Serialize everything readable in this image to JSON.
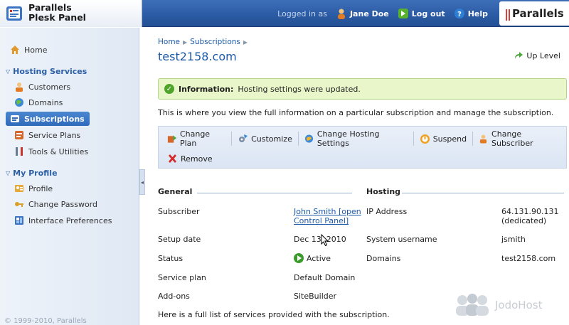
{
  "header": {
    "logo_line1": "Parallels",
    "logo_line2": "Plesk Panel",
    "logged_in_label": "Logged in as",
    "user_name": "Jane Doe",
    "logout_label": "Log out",
    "help_label": "Help",
    "brand": "Parallels",
    "brand_marks": "||"
  },
  "sidebar": {
    "home": "Home",
    "section1": "Hosting Services",
    "items1": [
      "Customers",
      "Domains",
      "Subscriptions",
      "Service Plans",
      "Tools & Utilities"
    ],
    "section2": "My Profile",
    "items2": [
      "Profile",
      "Change Password",
      "Interface Preferences"
    ],
    "copyright": "© 1999-2010, Parallels"
  },
  "main": {
    "breadcrumb": [
      "Home",
      "Subscriptions"
    ],
    "title": "test2158.com",
    "up_level": "Up Level",
    "info_label": "Information:",
    "info_text": "Hosting settings were updated.",
    "description": "This is where you view the full information on a particular subscription and manage the subscription.",
    "toolbar": [
      "Change Plan",
      "Customize",
      "Change Hosting Settings",
      "Suspend",
      "Change Subscriber",
      "Remove"
    ],
    "general": {
      "heading": "General",
      "rows": [
        {
          "label": "Subscriber",
          "value": "John Smith [open Control Panel]",
          "value_l1": "John Smith [open",
          "value_l2": "Control Panel]"
        },
        {
          "label": "Setup date",
          "value": "Dec 13, 2010"
        },
        {
          "label": "Status",
          "value": "Active"
        },
        {
          "label": "Service plan",
          "value": "Default Domain"
        },
        {
          "label": "Add-ons",
          "value": "SiteBuilder"
        }
      ]
    },
    "hosting": {
      "heading": "Hosting",
      "rows": [
        {
          "label": "IP Address",
          "value_l1": "64.131.90.131",
          "value_l2": "(dedicated)"
        },
        {
          "label": "System username",
          "value_l1": "jsmith"
        },
        {
          "label": "Domains",
          "value_l1": "test2158.com"
        }
      ]
    },
    "footer_note": "Here is a full list of services provided with the subscription."
  },
  "watermark": "JodoHost"
}
